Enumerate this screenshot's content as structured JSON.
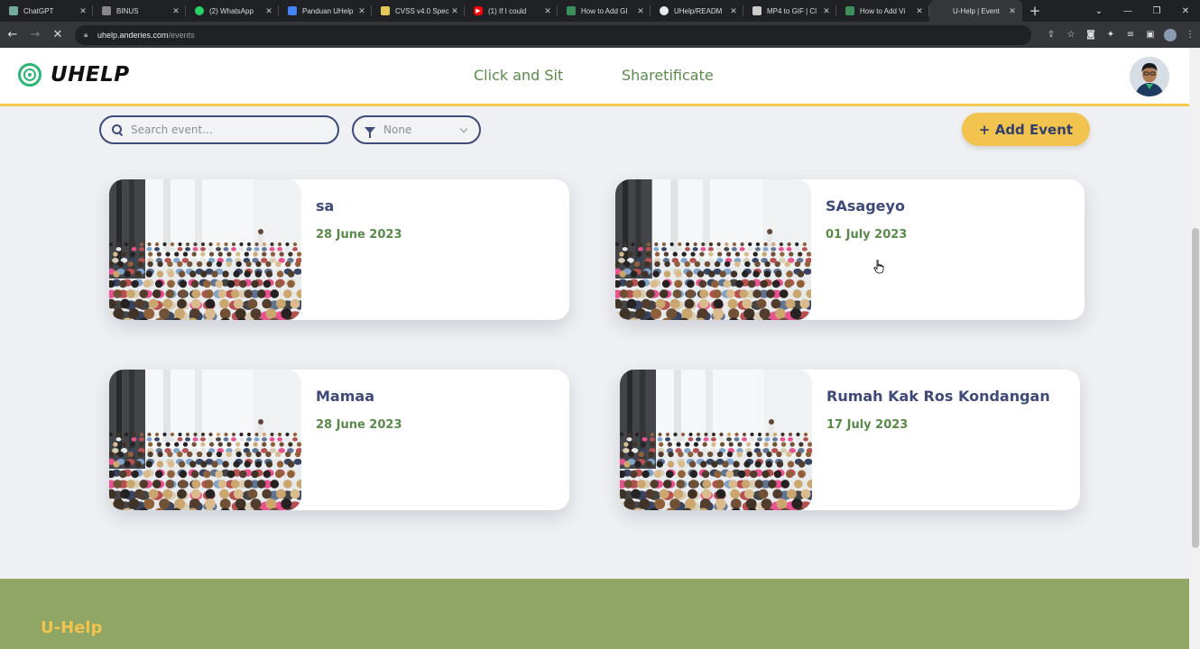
{
  "browser": {
    "tabs": [
      {
        "title": "ChatGPT",
        "icon": "chatgpt-icon",
        "color": "#74aa9c"
      },
      {
        "title": "BINUS",
        "icon": "binus-icon",
        "color": "#888888"
      },
      {
        "title": "(2) WhatsApp",
        "icon": "whatsapp-icon",
        "color": "#25d366"
      },
      {
        "title": "Panduan UHelp",
        "icon": "docs-icon",
        "color": "#4285f4"
      },
      {
        "title": "CVSS v4.0 Spec",
        "icon": "cvss-icon",
        "color": "#e3c75a"
      },
      {
        "title": "(1) If I could",
        "icon": "youtube-icon",
        "color": "#ff0000"
      },
      {
        "title": "How to Add GI",
        "icon": "gif-icon",
        "color": "#3b8f5a"
      },
      {
        "title": "UHelp/READM",
        "icon": "github-icon",
        "color": "#e8eaed"
      },
      {
        "title": "MP4 to GIF | Cl",
        "icon": "cloud-icon",
        "color": "#cccccc"
      },
      {
        "title": "How to Add Vi",
        "icon": "gif-icon",
        "color": "#3b8f5a"
      },
      {
        "title": "U-Help | Event",
        "icon": "",
        "color": "#35363a"
      }
    ],
    "url_host": "uhelp.anderies.com",
    "url_path": "/events"
  },
  "header": {
    "logo_text": "UHELP",
    "nav": [
      "Click and Sit",
      "Sharetificate"
    ]
  },
  "toolbar": {
    "search_placeholder": "Search event...",
    "filter_value": "None",
    "add_label": "+ Add Event"
  },
  "events": [
    {
      "title": "sa",
      "date": "28 June 2023"
    },
    {
      "title": "SAsageyo",
      "date": "01 July 2023"
    },
    {
      "title": "Mamaa",
      "date": "28 June 2023"
    },
    {
      "title": "Rumah Kak Ros Kondangan",
      "date": "17 July 2023"
    }
  ],
  "footer": {
    "brand": "U-Help"
  },
  "colors": {
    "accent": "#f2c34f",
    "primary": "#3d4a7a",
    "green": "#5a8a4a",
    "footer": "#8fa664"
  }
}
